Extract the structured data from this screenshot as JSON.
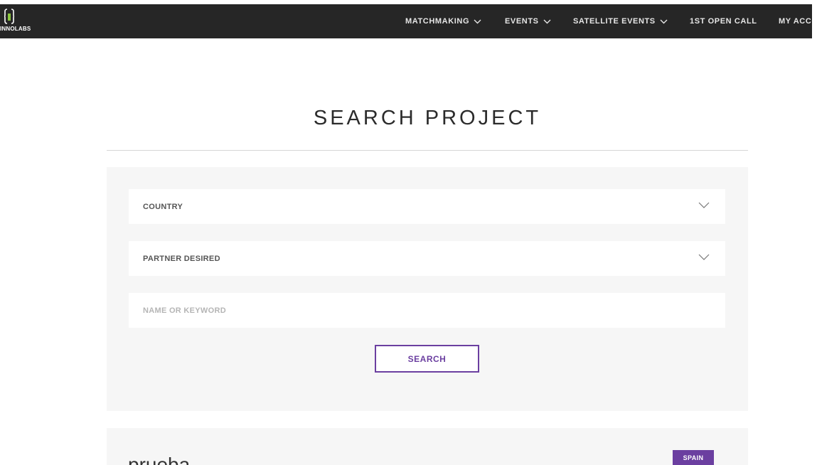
{
  "header": {
    "logo_text": "INNOLABS",
    "nav": [
      {
        "label": "MATCHMAKING",
        "has_dropdown": true
      },
      {
        "label": "EVENTS",
        "has_dropdown": true
      },
      {
        "label": "SATELLITE EVENTS",
        "has_dropdown": true
      },
      {
        "label": "1ST OPEN CALL",
        "has_dropdown": false
      },
      {
        "label": "MY ACCO",
        "has_dropdown": false
      }
    ]
  },
  "page": {
    "title": "SEARCH PROJECT"
  },
  "search": {
    "country_label": "COUNTRY",
    "partner_label": "PARTNER DESIRED",
    "keyword_placeholder": "NAME OR KEYWORD",
    "keyword_value": "",
    "button_label": "SEARCH"
  },
  "results": [
    {
      "name": "prueba",
      "country": "SPAIN"
    }
  ],
  "colors": {
    "nav_bg": "#262626",
    "accent": "#6b3fa0",
    "panel_bg": "#f6f6f6",
    "logo_accent": "#8cc63f"
  },
  "icons": {
    "logo": "innolabs-logo-icon",
    "dropdown": "chevron-down-icon"
  }
}
